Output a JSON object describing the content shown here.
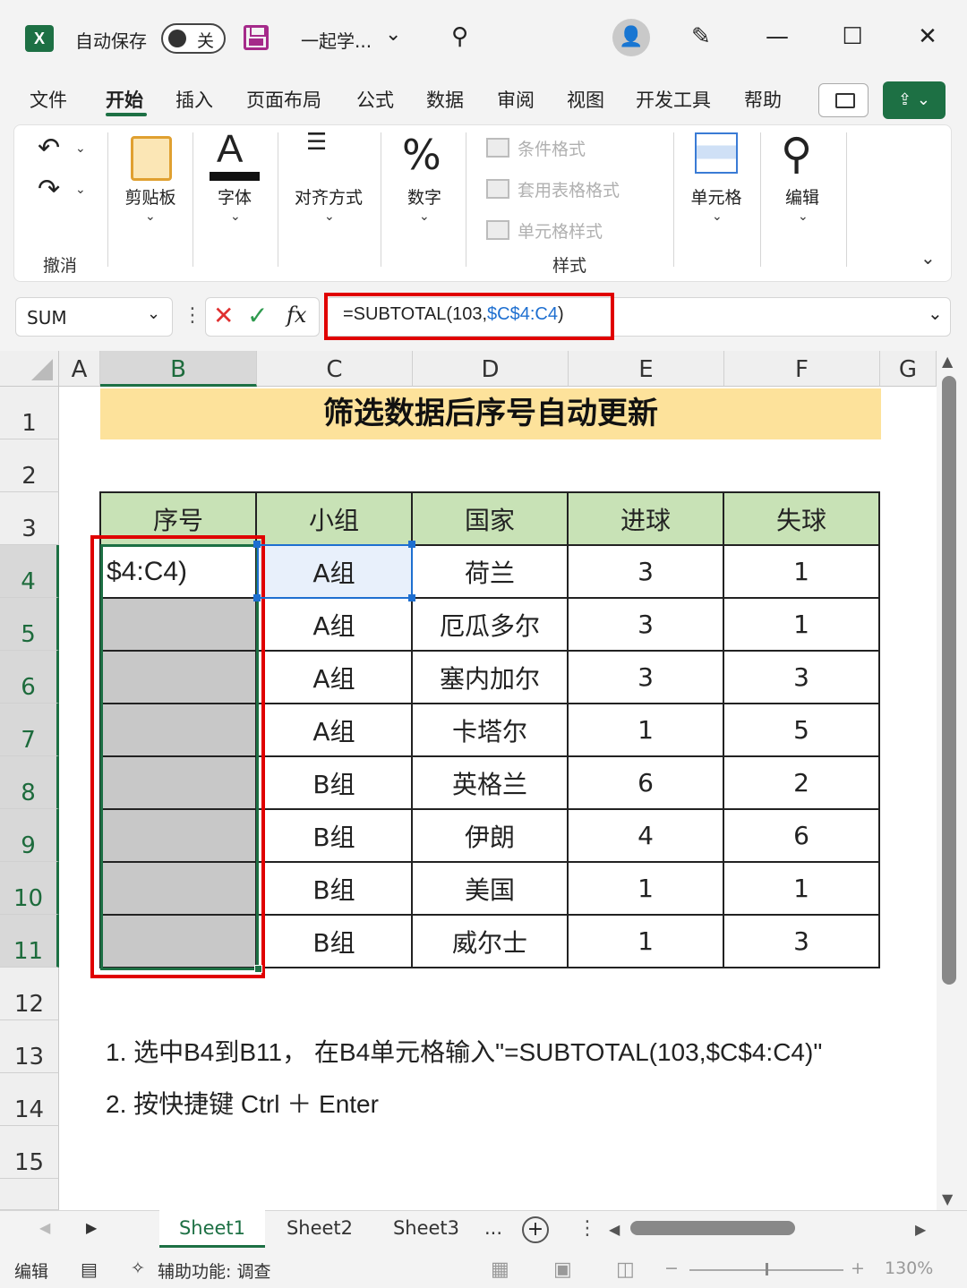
{
  "titlebar": {
    "app_icon": "excel-icon",
    "autosave_label": "自动保存",
    "autosave_state": "关",
    "filename": "一起学...",
    "search_icon": "search-icon",
    "avatar_icon": "user-icon",
    "pen_icon": "pen-icon"
  },
  "menu": {
    "tabs": [
      "文件",
      "开始",
      "插入",
      "页面布局",
      "公式",
      "数据",
      "审阅",
      "视图",
      "开发工具",
      "帮助"
    ],
    "active": "开始"
  },
  "ribbon": {
    "undo_group": "撤消",
    "clipboard": "剪贴板",
    "font": "字体",
    "align": "对齐方式",
    "number": "数字",
    "cond_format": "条件格式",
    "table_format": "套用表格格式",
    "cell_style": "单元格样式",
    "style_group": "样式",
    "cells": "单元格",
    "edit": "编辑"
  },
  "formula_bar": {
    "name_box": "SUM",
    "fx": "fx",
    "formula_prefix": "=SUBTOTAL(103,",
    "formula_ref": "$C$4:C4",
    "formula_suffix": ")"
  },
  "grid": {
    "columns": [
      "A",
      "B",
      "C",
      "D",
      "E",
      "F",
      "G"
    ],
    "rows": [
      "1",
      "2",
      "3",
      "4",
      "5",
      "6",
      "7",
      "8",
      "9",
      "10",
      "11",
      "12",
      "13",
      "14",
      "15"
    ],
    "title": "筛选数据后序号自动更新",
    "table_headers": [
      "序号",
      "小组",
      "国家",
      "进球",
      "失球"
    ],
    "active_cell_text": "$4:C4)",
    "table_rows": [
      {
        "group": "A组",
        "country": "荷兰",
        "goals_for": "3",
        "goals_against": "1"
      },
      {
        "group": "A组",
        "country": "厄瓜多尔",
        "goals_for": "3",
        "goals_against": "1"
      },
      {
        "group": "A组",
        "country": "塞内加尔",
        "goals_for": "3",
        "goals_against": "3"
      },
      {
        "group": "A组",
        "country": "卡塔尔",
        "goals_for": "1",
        "goals_against": "5"
      },
      {
        "group": "B组",
        "country": "英格兰",
        "goals_for": "6",
        "goals_against": "2"
      },
      {
        "group": "B组",
        "country": "伊朗",
        "goals_for": "4",
        "goals_against": "6"
      },
      {
        "group": "B组",
        "country": "美国",
        "goals_for": "1",
        "goals_against": "1"
      },
      {
        "group": "B组",
        "country": "威尔士",
        "goals_for": "1",
        "goals_against": "3"
      }
    ],
    "note1": "1. 选中B4到B11， 在B4单元格输入\"=SUBTOTAL(103,$C$4:C4)\"",
    "note2": "2. 按快捷键 Ctrl ＋ Enter"
  },
  "sheets": {
    "tabs": [
      "Sheet1",
      "Sheet2",
      "Sheet3"
    ],
    "more": "...",
    "active": "Sheet1"
  },
  "statusbar": {
    "mode": "编辑",
    "accessibility": "辅助功能: 调查",
    "zoom": "130%"
  },
  "colors": {
    "accent": "#1d7044",
    "highlight_red": "#e00000",
    "title_band": "#fde29b",
    "header_fill": "#c8e2b6"
  }
}
